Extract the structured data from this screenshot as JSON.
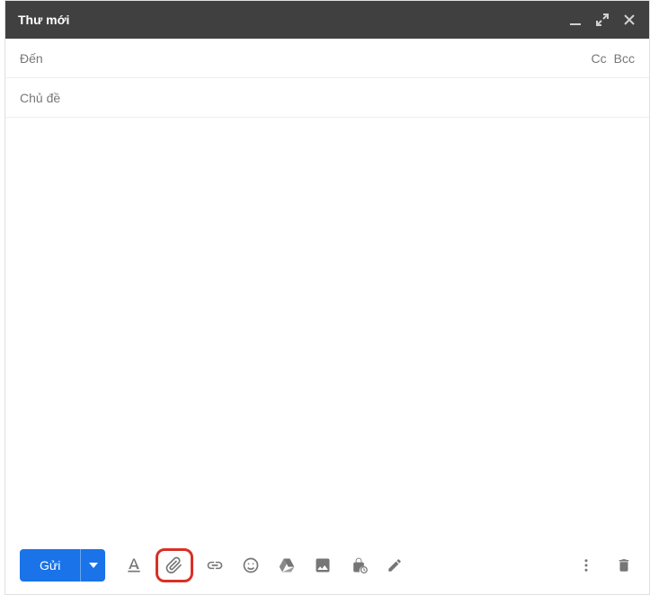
{
  "titlebar": {
    "title": "Thư mới"
  },
  "recipients": {
    "to_placeholder": "Đến",
    "to_value": "",
    "cc_label": "Cc",
    "bcc_label": "Bcc"
  },
  "subject": {
    "placeholder": "Chủ đề",
    "value": ""
  },
  "body": {
    "value": ""
  },
  "footer": {
    "send_label": "Gửi"
  },
  "colors": {
    "primary": "#1a73e8",
    "highlight": "#d93025",
    "icon": "#767676",
    "titlebar": "#404040"
  }
}
